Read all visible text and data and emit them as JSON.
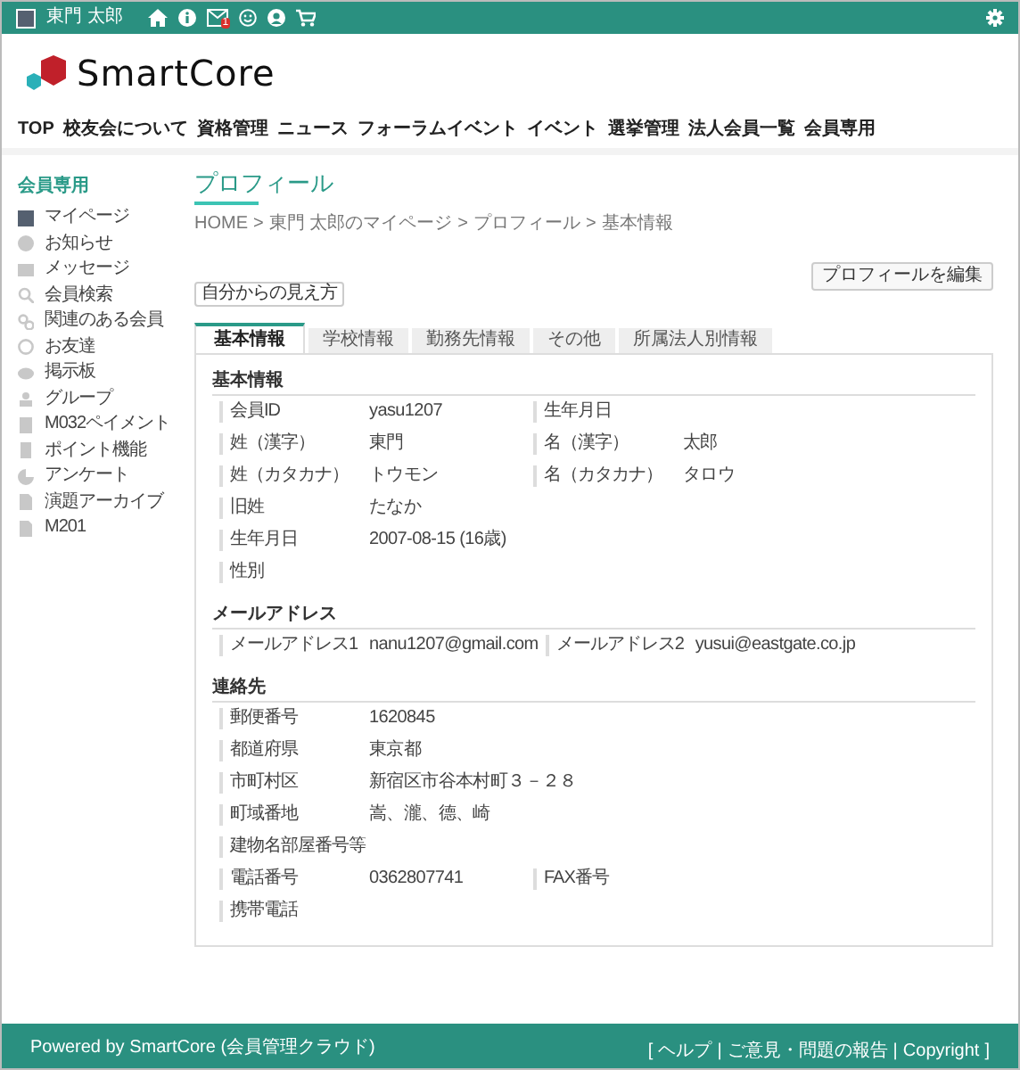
{
  "top_bar": {
    "user_name": "東門 太郎",
    "mail_badge": "1"
  },
  "logo": {
    "text": "SmartCore"
  },
  "nav": [
    "TOP",
    "校友会について",
    "資格管理",
    "ニュース",
    "フォーラムイベント",
    "イベント",
    "選挙管理",
    "法人会員一覧",
    "会員専用"
  ],
  "sidebar": {
    "title": "会員専用",
    "items": [
      "マイページ",
      "お知らせ",
      "メッセージ",
      "会員検索",
      "関連のある会員",
      "お友達",
      "掲示板",
      "グループ",
      "M032ペイメント",
      "ポイント機能",
      "アンケート",
      "演題アーカイブ",
      "M201"
    ]
  },
  "page": {
    "title": "プロフィール",
    "breadcrumb": [
      "HOME",
      "東門 太郎のマイページ",
      "プロフィール",
      "基本情報"
    ],
    "breadcrumb_separator": ">",
    "edit_button": "プロフィールを編集",
    "view_select": "自分からの見え方"
  },
  "tabs": [
    {
      "label": "基本情報",
      "selected": true
    },
    {
      "label": "学校情報",
      "selected": false
    },
    {
      "label": "勤務先情報",
      "selected": false
    },
    {
      "label": "その他",
      "selected": false
    },
    {
      "label": "所属法人別情報",
      "selected": false
    }
  ],
  "sections": [
    {
      "title": "基本情報",
      "rows": [
        [
          {
            "label": "会員ID",
            "value": "yasu1207"
          },
          {
            "label": "生年月日"
          }
        ],
        [
          {
            "label": "姓（漢字）",
            "value": "東門"
          },
          {
            "label": "名（漢字）",
            "value": "太郎"
          }
        ],
        [
          {
            "label": "姓（カタカナ）",
            "value": "トウモン"
          },
          {
            "label": "名（カタカナ）",
            "value": "タロウ"
          }
        ],
        [
          {
            "label": "旧姓",
            "value": "たなか"
          }
        ],
        [
          {
            "label": "生年月日",
            "value": "2007-08-15 (16歳)"
          }
        ],
        [
          {
            "label": "性別"
          }
        ]
      ]
    },
    {
      "title": "メールアドレス",
      "rows": [
        [
          {
            "label": "メールアドレス1",
            "value": "nanu1207@gmail.com"
          },
          {
            "label": "メールアドレス2",
            "value": "yusui@eastgate.co.jp"
          }
        ]
      ]
    },
    {
      "title": "連絡先",
      "rows": [
        [
          {
            "label": "郵便番号",
            "value": "1620845"
          }
        ],
        [
          {
            "label": "都道府県",
            "value": "東京都"
          }
        ],
        [
          {
            "label": "市町村区",
            "value": "新宿区市谷本村町３－２８"
          }
        ],
        [
          {
            "label": "町域番地",
            "value": "嵩、瀧、德、崎"
          }
        ],
        [
          {
            "label": "建物名部屋番号等"
          }
        ],
        [
          {
            "label": "電話番号",
            "value": "0362807741"
          },
          {
            "label": "FAX番号"
          }
        ],
        [
          {
            "label": "携帯電話"
          }
        ]
      ]
    }
  ],
  "footer": {
    "powered_by": "Powered by SmartCore (会員管理クラウド)",
    "open_bracket": "[",
    "links": [
      "ヘルプ",
      "ご意見・問題の報告",
      "Copyright"
    ],
    "separator": "|",
    "close_bracket": "]"
  }
}
